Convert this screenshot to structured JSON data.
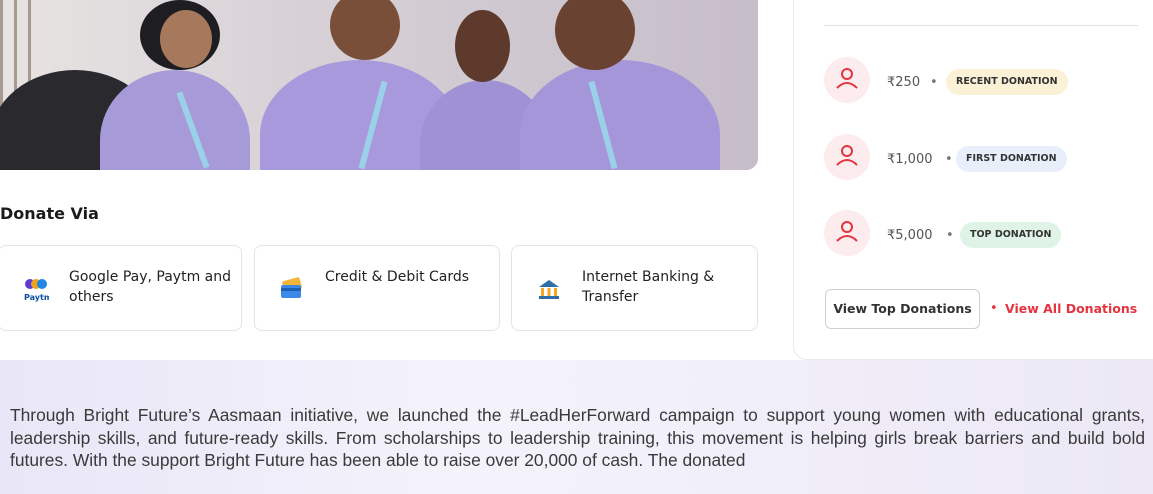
{
  "donate_via": {
    "title": "Donate Via",
    "methods": [
      {
        "label": "Google Pay, Paytm and others",
        "icon": "upi-paytm-icon"
      },
      {
        "label": "Credit & Debit Cards",
        "icon": "credit-card-icon"
      },
      {
        "label": "Internet Banking & Transfer",
        "icon": "bank-icon"
      }
    ]
  },
  "donations": {
    "items": [
      {
        "amount": "₹250",
        "badge": "RECENT DONATION"
      },
      {
        "amount": "₹1,000",
        "badge": "FIRST DONATION"
      },
      {
        "amount": "₹5,000",
        "badge": "TOP DONATION"
      }
    ],
    "separator": "•",
    "view_top_label": "View Top Donations",
    "view_all_label": "View All Donations"
  },
  "story": {
    "paragraph": "Through Bright Future’s Aasmaan initiative, we launched the #LeadHerForward campaign to support young women with educational grants, leadership skills, and future-ready skills. From scholarships to leadership training, this movement is helping girls break barriers and build bold futures. With the support Bright Future has been able to raise over 20,000 of cash. The donated"
  },
  "colors": {
    "accent": "#e3343f",
    "recent_badge": "#fbf1d6",
    "first_badge": "#e8effb",
    "top_badge": "#dff3e6"
  }
}
